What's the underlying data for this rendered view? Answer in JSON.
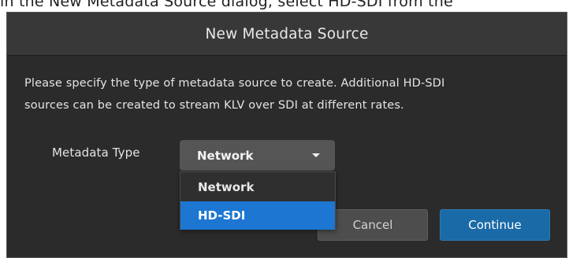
{
  "background": {
    "caption": "in the New Metadata Source dialog, select HD-SDI from the"
  },
  "dialog": {
    "title": "New Metadata Source",
    "description_line1": "Please specify the type of metadata source to create. Additional HD-SDI",
    "description_line2": "sources can be created to stream KLV over SDI at different rates.",
    "metadata_type_label": "Metadata Type",
    "select": {
      "value": "Network",
      "icon": "chevron-down-icon"
    },
    "dropdown": {
      "options": [
        "Network",
        "HD-SDI"
      ],
      "highlighted": "HD-SDI"
    },
    "buttons": {
      "cancel": "Cancel",
      "continue": "Continue"
    }
  },
  "colors": {
    "dialog_bg": "#2b2b2b",
    "header_bg": "#383838",
    "select_bg": "#555555",
    "highlight": "#1c76d2",
    "primary_button": "#1a6aa8",
    "secondary_button": "#4d4d4d"
  }
}
